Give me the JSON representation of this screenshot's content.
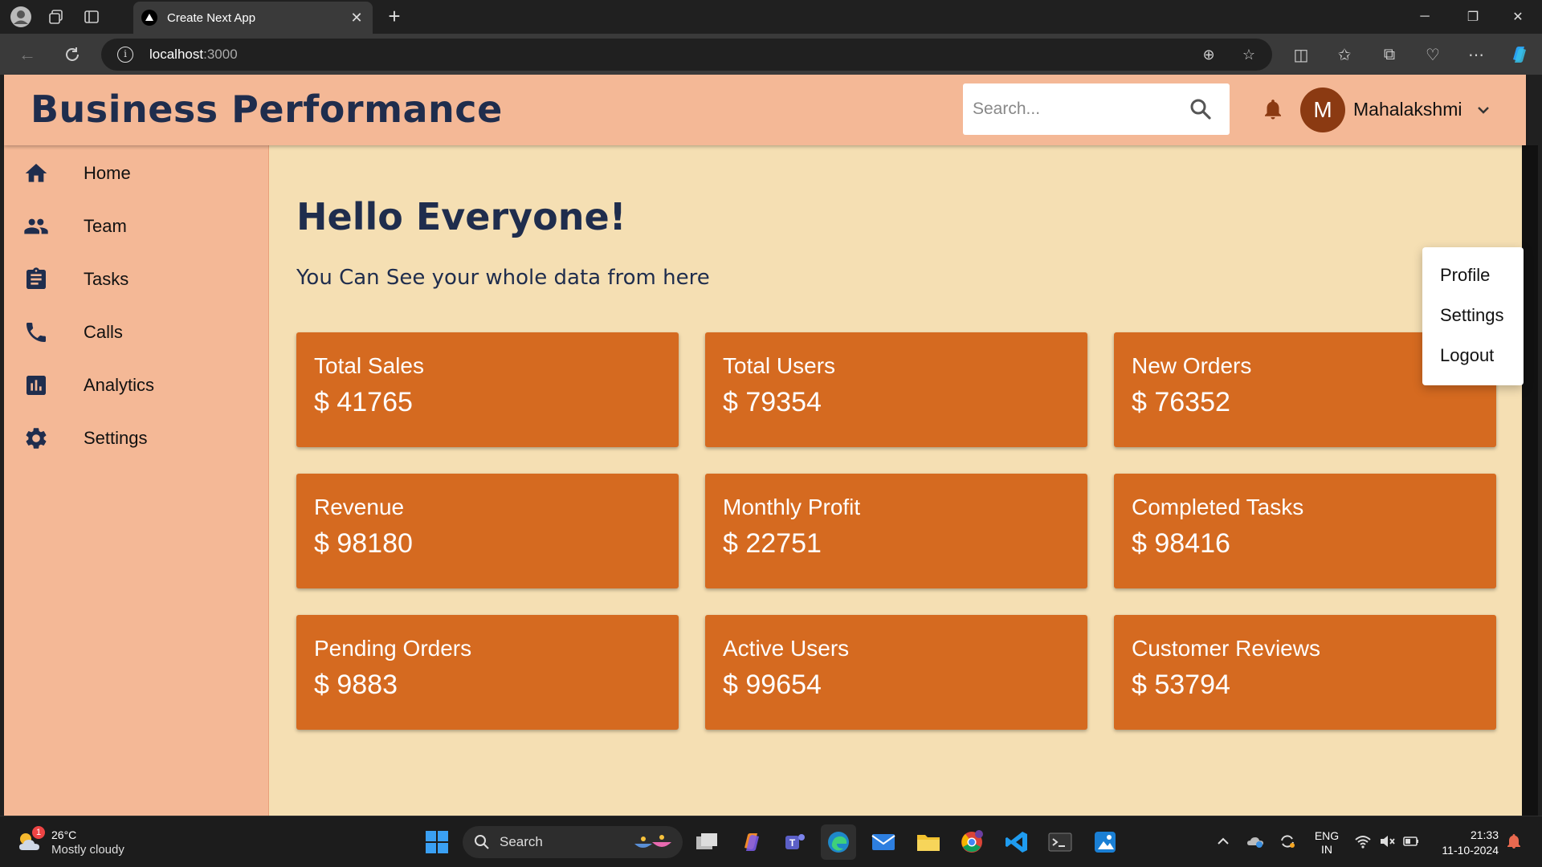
{
  "browser": {
    "tab_title": "Create Next App",
    "url_host": "localhost",
    "url_port": ":3000"
  },
  "app": {
    "brand": "Business Performance",
    "search": {
      "placeholder": "Search..."
    },
    "user": {
      "initial": "M",
      "name": "Mahalakshmi"
    },
    "sidebar": [
      {
        "label": "Home",
        "icon": "home-icon"
      },
      {
        "label": "Team",
        "icon": "team-icon"
      },
      {
        "label": "Tasks",
        "icon": "tasks-icon"
      },
      {
        "label": "Calls",
        "icon": "phone-icon"
      },
      {
        "label": "Analytics",
        "icon": "analytics-icon"
      },
      {
        "label": "Settings",
        "icon": "gear-icon"
      }
    ],
    "greeting": "Hello Everyone!",
    "subtitle": "You Can See your whole data from here",
    "cards": [
      {
        "title": "Total Sales",
        "value": "$ 41765"
      },
      {
        "title": "Total Users",
        "value": "$ 79354"
      },
      {
        "title": "New Orders",
        "value": "$ 76352"
      },
      {
        "title": "Revenue",
        "value": "$ 98180"
      },
      {
        "title": "Monthly Profit",
        "value": "$ 22751"
      },
      {
        "title": "Completed Tasks",
        "value": "$ 98416"
      },
      {
        "title": "Pending Orders",
        "value": "$ 9883"
      },
      {
        "title": "Active Users",
        "value": "$ 99654"
      },
      {
        "title": "Customer Reviews",
        "value": "$ 53794"
      }
    ],
    "user_menu": [
      "Profile",
      "Settings",
      "Logout"
    ],
    "colors": {
      "header": "#f4b896",
      "background": "#f5dfb3",
      "card": "#d56a20",
      "text": "#1f2d4d"
    }
  },
  "taskbar": {
    "weather": {
      "temp": "26°C",
      "condition": "Mostly cloudy",
      "badge": "1"
    },
    "search_label": "Search",
    "lang": {
      "line1": "ENG",
      "line2": "IN"
    },
    "time": "21:33",
    "date": "11-10-2024"
  }
}
